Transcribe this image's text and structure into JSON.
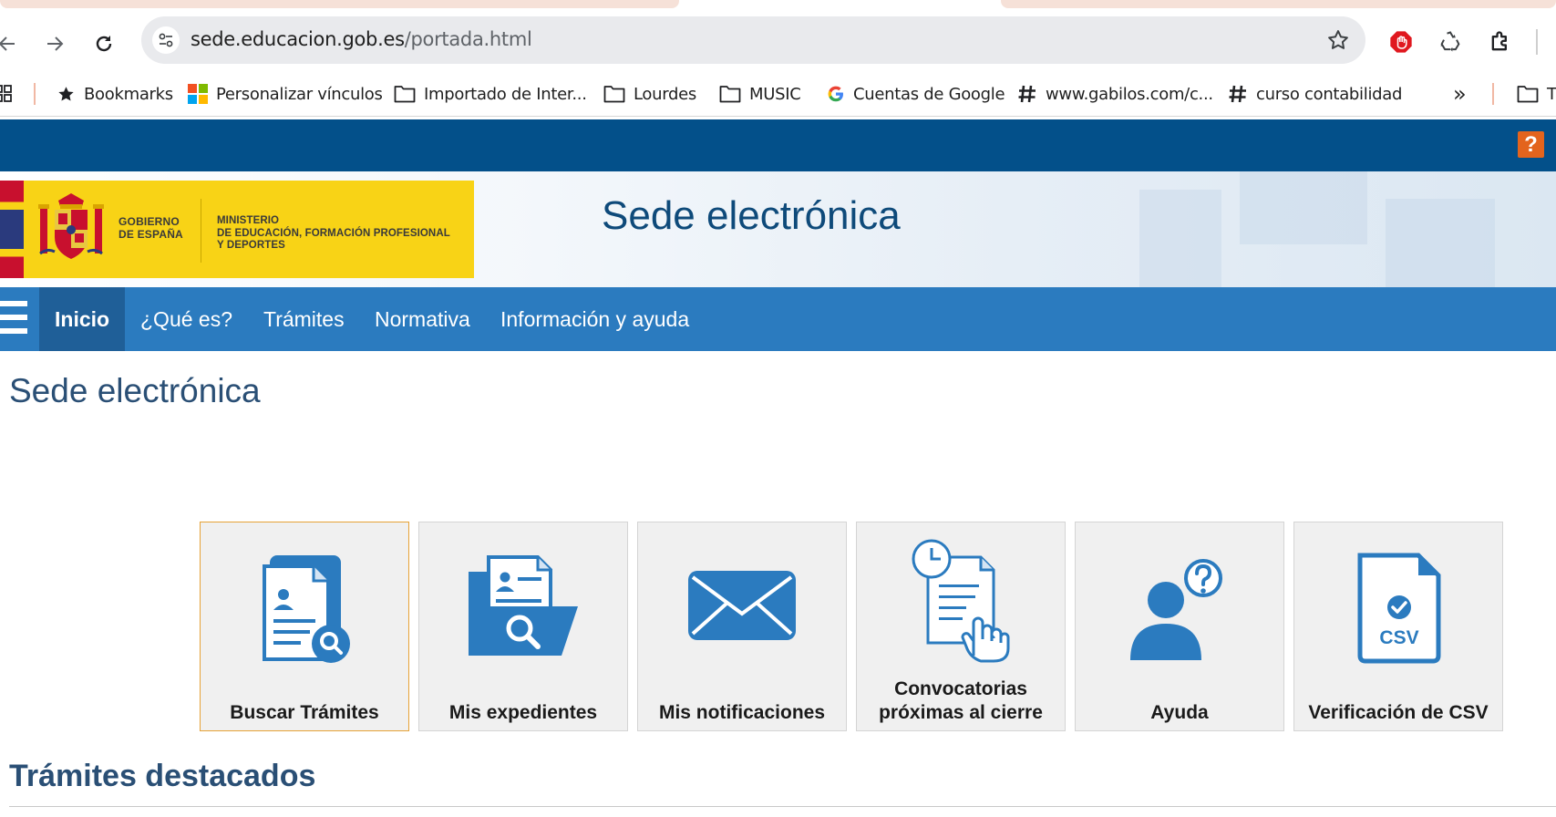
{
  "browser": {
    "url_domain": "sede.educacion.gob.es",
    "url_path": "/portada.html",
    "icons": [
      "back-icon",
      "forward-icon",
      "reload-icon",
      "site-info-icon",
      "bookmark-star-icon",
      "adblock-icon",
      "recycle-extension-icon",
      "extensions-puzzle-icon"
    ]
  },
  "bookmarks": {
    "items": [
      {
        "label": "Bookmarks",
        "icon": "star-icon"
      },
      {
        "label": "Personalizar vínculos",
        "icon": "microsoft-logo-icon"
      },
      {
        "label": "Importado de Inter...",
        "icon": "folder-icon"
      },
      {
        "label": "Lourdes",
        "icon": "folder-icon"
      },
      {
        "label": "MUSIC",
        "icon": "folder-icon"
      },
      {
        "label": "Cuentas de Google",
        "icon": "google-logo-icon"
      },
      {
        "label": "www.gabilos.com/c...",
        "icon": "hash-icon"
      },
      {
        "label": "curso contabilidad",
        "icon": "hash-icon"
      },
      {
        "label": "T",
        "icon": "folder-icon"
      }
    ],
    "overflow": "»"
  },
  "site": {
    "help_label": "?",
    "logo": {
      "gov_line1": "GOBIERNO",
      "gov_line2": "DE ESPAÑA",
      "min_line1": "MINISTERIO",
      "min_line2": "DE EDUCACIÓN, FORMACIÓN PROFESIONAL",
      "min_line3": "Y DEPORTES"
    },
    "header_title": "Sede electrónica",
    "nav": [
      "Inicio",
      "¿Qué es?",
      "Trámites",
      "Normativa",
      "Información y ayuda"
    ],
    "page_title": "Sede electrónica",
    "tiles": [
      {
        "label": "Buscar Trámites"
      },
      {
        "label": "Mis expedientes"
      },
      {
        "label": "Mis notificaciones"
      },
      {
        "label_line1": "Convocatorias",
        "label_line2": "próximas al cierre"
      },
      {
        "label": "Ayuda"
      },
      {
        "label": "Verificación de CSV",
        "badge": "CSV"
      }
    ],
    "section_title": "Trámites destacados"
  },
  "colors": {
    "topbar": "#03508a",
    "nav": "#2b7bbf",
    "nav_active": "#1f5f98",
    "icon_blue": "#2b7bbf",
    "help_orange": "#e3641d",
    "logo_yellow": "#f8d316",
    "title_blue": "#2a4f75"
  }
}
